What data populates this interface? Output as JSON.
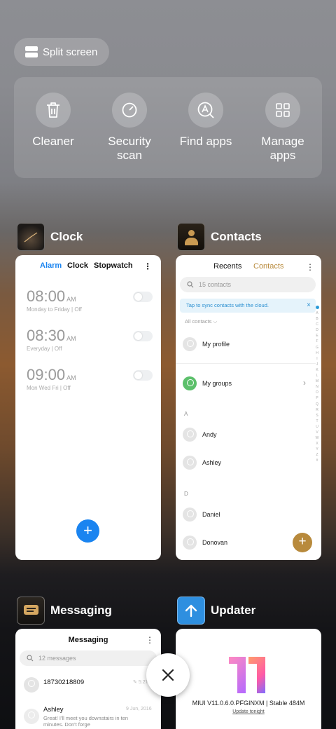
{
  "split_screen": {
    "label": "Split screen"
  },
  "tools": [
    {
      "label": "Cleaner",
      "icon": "trash-icon"
    },
    {
      "label": "Security\nscan",
      "icon": "shield-gauge-icon"
    },
    {
      "label": "Find apps",
      "icon": "find-apps-icon"
    },
    {
      "label": "Manage\napps",
      "icon": "grid-icon"
    }
  ],
  "apps": {
    "clock": {
      "title": "Clock",
      "tabs": [
        "Alarm",
        "Clock",
        "Stopwatch"
      ],
      "alarms": [
        {
          "time": "08:00",
          "ampm": "AM",
          "days": "Monday to Friday",
          "state": "Off"
        },
        {
          "time": "08:30",
          "ampm": "AM",
          "days": "Everyday",
          "state": "Off"
        },
        {
          "time": "09:00",
          "ampm": "AM",
          "days": "Mon Wed Fri",
          "state": "Off"
        }
      ],
      "fab": "+"
    },
    "contacts": {
      "title": "Contacts",
      "tabs": [
        "Recents",
        "Contacts"
      ],
      "search_placeholder": "15 contacts",
      "sync_text": "Tap to sync contacts with the cloud.",
      "filter": "All contacts",
      "rows": [
        "My profile",
        "My groups",
        "Andy",
        "Ashley",
        "Daniel",
        "Donovan"
      ],
      "sections": [
        "A",
        "D"
      ],
      "alphabet": "ABCDEFGHIJKLMNOPQRSTUVWXYZ#",
      "fab": "+"
    },
    "messaging": {
      "title": "Messaging",
      "header": "Messaging",
      "search_placeholder": "12 messages",
      "messages": [
        {
          "sender": "18730218809",
          "time": "5:27 P",
          "snippet": ""
        },
        {
          "sender": "Ashley",
          "time": "9 Jun, 2016",
          "snippet": "Great! I'll meet you downstairs in ten minutes. Don't forge"
        }
      ]
    },
    "updater": {
      "title": "Updater",
      "version": "MIUI V11.0.6.0.PFGINXM | Stable 484M",
      "link": "Update tonight"
    }
  },
  "colors": {
    "blue": "#1a84f0",
    "gold": "#b88a3c",
    "green": "#5cc06b"
  }
}
